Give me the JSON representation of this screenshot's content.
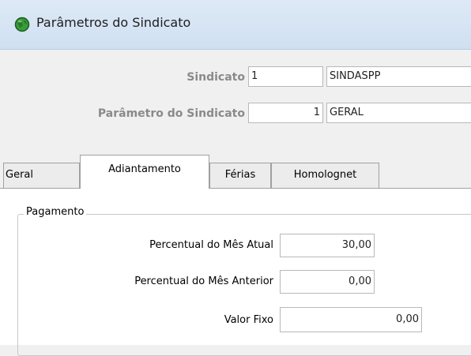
{
  "window": {
    "title": "Parâmetros do Sindicato",
    "icon": "globe-icon"
  },
  "header": {
    "sindicato_label": "Sindicato",
    "sindicato_code": "1",
    "sindicato_name": "SINDASPP",
    "parametro_label": "Parâmetro do Sindicato",
    "parametro_code": "1",
    "parametro_name": "GERAL"
  },
  "tabs": [
    {
      "label": "Geral"
    },
    {
      "label": "Adiantamento",
      "active": true
    },
    {
      "label": "Férias"
    },
    {
      "label": "Homolognet"
    }
  ],
  "pagamento": {
    "group_label": "Pagamento",
    "percentual_atual_label": "Percentual do Mês Atual",
    "percentual_atual_value": "30,00",
    "percentual_anterior_label": "Percentual do Mês Anterior",
    "percentual_anterior_value": "0,00",
    "valor_fixo_label": "Valor Fixo",
    "valor_fixo_value": "0,00"
  }
}
